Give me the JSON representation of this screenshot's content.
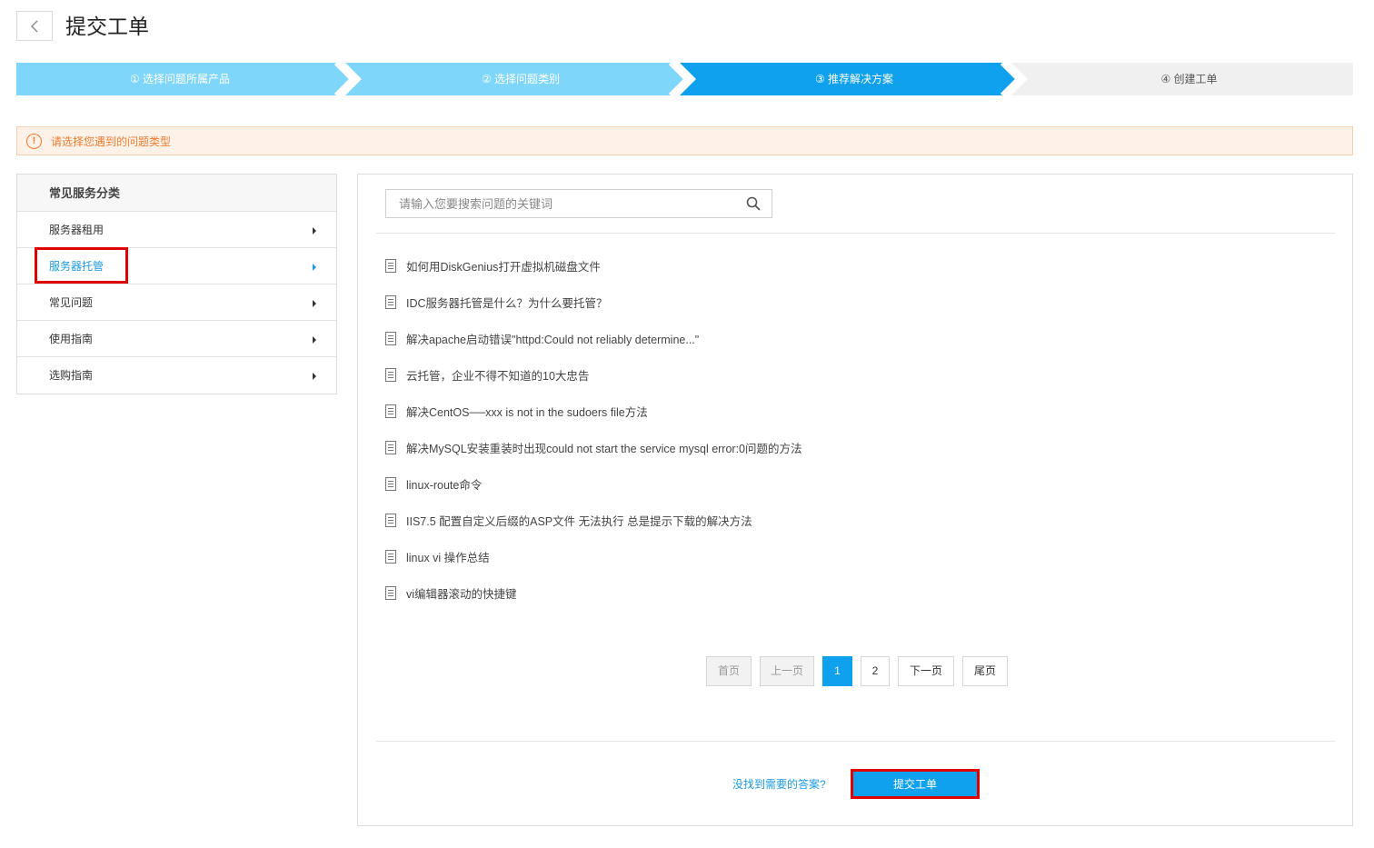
{
  "header": {
    "back_icon": "chevron-left-icon",
    "title": "提交工单"
  },
  "steps": [
    {
      "label": "① 选择问题所属产品",
      "state": "done"
    },
    {
      "label": "② 选择问题类别",
      "state": "done"
    },
    {
      "label": "③ 推荐解决方案",
      "state": "active"
    },
    {
      "label": "④ 创建工单",
      "state": "todo"
    }
  ],
  "colors": {
    "step_done": "#7fd6fb",
    "step_active": "#0fa0ee",
    "step_todo": "#f0f0f0",
    "accent": "#0fa0ee",
    "warning": "#ef7d2f",
    "highlight": "#e00000"
  },
  "alert": {
    "icon": "exclamation-circle-icon",
    "text": "请选择您遇到的问题类型"
  },
  "sidebar": {
    "title": "常见服务分类",
    "items": [
      {
        "label": "服务器租用",
        "active": false
      },
      {
        "label": "服务器托管",
        "active": true
      },
      {
        "label": "常见问题",
        "active": false
      },
      {
        "label": "使用指南",
        "active": false
      },
      {
        "label": "选购指南",
        "active": false
      }
    ]
  },
  "search": {
    "placeholder": "请输入您要搜索问题的关键词",
    "value": "",
    "icon": "search-icon"
  },
  "articles": [
    "如何用DiskGenius打开虚拟机磁盘文件",
    "IDC服务器托管是什么？为什么要托管？",
    "解决apache启动错误\"httpd:Could not reliably determine...\"",
    "云托管，企业不得不知道的10大忠告",
    "解决CentOS──xxx is not in the sudoers file方法",
    "解决MySQL安装重装时出现could not start the service mysql error:0问题的方法",
    "linux-route命令",
    "IIS7.5 配置自定义后缀的ASP文件 无法执行 总是提示下载的解决方法",
    "linux vi 操作总结",
    "vi编辑器滚动的快捷键"
  ],
  "pagination": {
    "first": "首页",
    "prev": "上一页",
    "pages": [
      "1",
      "2"
    ],
    "current": "1",
    "next": "下一页",
    "last": "尾页"
  },
  "footer": {
    "not_found_link": "没找到需要的答案?",
    "submit_label": "提交工单"
  }
}
